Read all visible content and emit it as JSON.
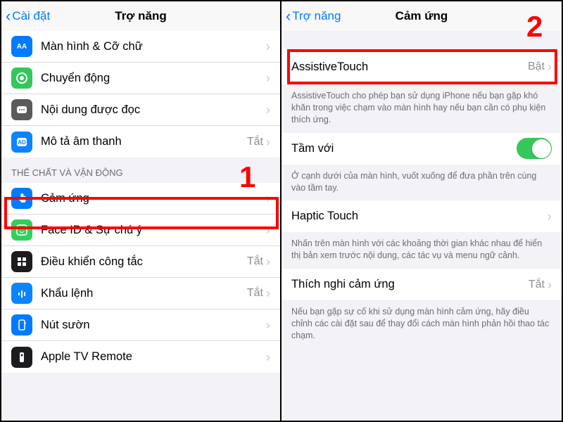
{
  "left": {
    "back_label": "Cài đặt",
    "title": "Trợ năng",
    "group1": [
      {
        "icon": "text-size-icon",
        "bg": "bg-blue",
        "label": "Màn hình & Cỡ chữ",
        "status": ""
      },
      {
        "icon": "motion-icon",
        "bg": "bg-green",
        "label": "Chuyển động",
        "status": ""
      },
      {
        "icon": "speech-icon",
        "bg": "bg-gray",
        "label": "Nội dung được đọc",
        "status": ""
      },
      {
        "icon": "audio-desc-icon",
        "bg": "bg-blue2",
        "label": "Mô tả âm thanh",
        "status": "Tắt"
      }
    ],
    "section2_header": "THỂ CHẤT VÀ VẬN ĐỘNG",
    "group2": [
      {
        "icon": "touch-icon",
        "bg": "bg-blue",
        "label": "Cảm ứng",
        "status": ""
      },
      {
        "icon": "faceid-icon",
        "bg": "bg-lime",
        "label": "Face ID & Sự chú ý",
        "status": ""
      },
      {
        "icon": "switch-icon",
        "bg": "bg-dark",
        "label": "Điều khiển công tắc",
        "status": "Tắt"
      },
      {
        "icon": "voice-icon",
        "bg": "bg-blue2",
        "label": "Khẩu lệnh",
        "status": "Tắt"
      },
      {
        "icon": "side-button-icon",
        "bg": "bg-blue",
        "label": "Nút sườn",
        "status": ""
      },
      {
        "icon": "appletv-icon",
        "bg": "bg-dark",
        "label": "Apple TV Remote",
        "status": ""
      }
    ]
  },
  "right": {
    "back_label": "Trợ năng",
    "title": "Cảm ứng",
    "assistive_label": "AssistiveTouch",
    "assistive_status": "Bật",
    "assistive_desc": "AssistiveTouch cho phép bạn sử dụng iPhone nếu bạn gặp khó khăn trong việc chạm vào màn hình hay nếu bạn cần có phụ kiện thích ứng.",
    "reach_label": "Tầm với",
    "reach_on": true,
    "reach_desc": "Ở cạnh dưới của màn hình, vuốt xuống để đưa phần trên cùng vào tầm tay.",
    "haptic_label": "Haptic Touch",
    "haptic_desc": "Nhấn trên màn hình với các khoảng thời gian khác nhau để hiển thị bản xem trước nội dung, các tác vụ và menu ngữ cảnh.",
    "accom_label": "Thích nghi cảm ứng",
    "accom_status": "Tắt",
    "accom_desc": "Nếu bạn gặp sự cố khi sử dụng màn hình cảm ứng, hãy điều chỉnh các cài đặt sau để thay đổi cách màn hình phản hồi thao tác chạm."
  },
  "badge1": "1",
  "badge2": "2"
}
